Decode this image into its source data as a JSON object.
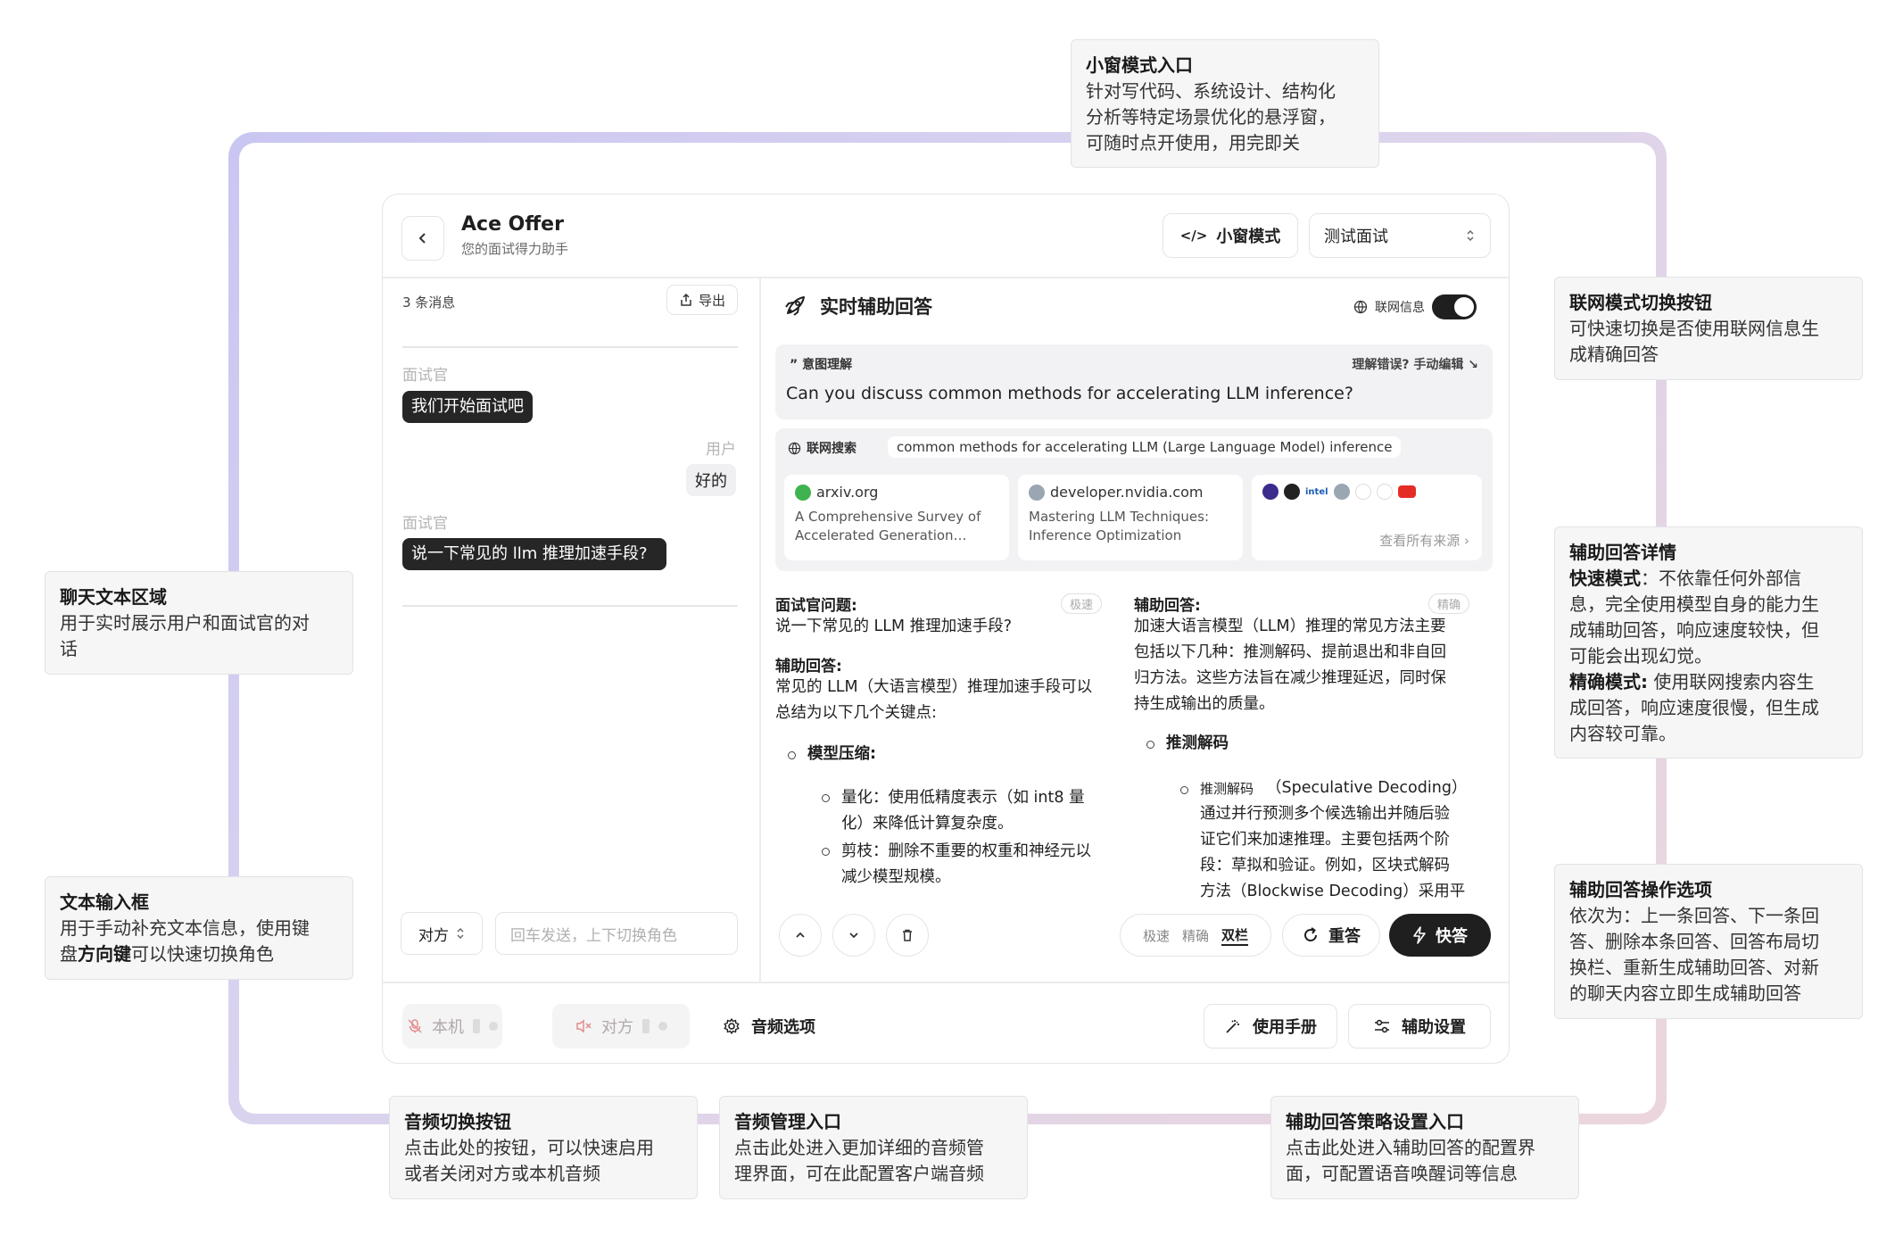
{
  "app": {
    "title": "Ace Offer",
    "subtitle": "您的面试得力助手",
    "mini_mode_label": "小窗模式",
    "interview_select": "测试面试"
  },
  "chat": {
    "message_count": "3 条消息",
    "export_label": "导出",
    "messages": [
      {
        "role": "面试官",
        "text": "我们开始面试吧"
      },
      {
        "role": "用户",
        "text": "好的"
      },
      {
        "role": "面试官",
        "text": "说一下常见的 llm 推理加速手段?"
      }
    ],
    "role_selector": "对方",
    "input_placeholder": "回车发送，上下切换角色"
  },
  "assist": {
    "title": "实时辅助回答",
    "web_toggle_label": "联网信息",
    "web_toggle_on": true,
    "intent_label": "意图理解",
    "intent_edit": "理解错误? 手动编辑",
    "intent_question": "Can you discuss common methods for accelerating LLM inference?",
    "search_label": "联网搜索",
    "search_query": "common methods for accelerating LLM (Large Language Model) inference",
    "sources": [
      {
        "domain": "arxiv.org",
        "title": "A Comprehensive Survey of Accelerated Generation…",
        "icon": "arxiv-icon",
        "color": "#3fb34f"
      },
      {
        "domain": "developer.nvidia.com",
        "title": "Mastering LLM Techniques: Inference Optimization",
        "icon": "nvidia-icon",
        "color": "#9aa6b2"
      }
    ],
    "more_sources": "查看所有来源",
    "left_col": {
      "q_head": "面试官问题:",
      "mode_pill": "极速",
      "q_text": "说一下常见的 LLM 推理加速手段?",
      "a_head": "辅助回答:",
      "a_text_1": "常见的 LLM（大语言模型）推理加速手段可以",
      "a_text_2": "总结为以下几个关键点:",
      "bullet": "模型压缩:",
      "sub1_1": "量化：使用低精度表示（如 int8 量",
      "sub1_2": "化）来降低计算复杂度。",
      "sub2_1": "剪枝：删除不重要的权重和神经元以",
      "sub2_2": "减少模型规模。"
    },
    "right_col": {
      "a_head": "辅助回答:",
      "mode_pill": "精确",
      "p1": "加速大语言模型（LLM）推理的常见方法主要",
      "p2": "包括以下几种：推测解码、提前退出和非自回",
      "p3": "归方法。这些方法旨在减少推理延迟，同时保",
      "p4": "持生成输出的质量。",
      "bullet": "推测解码",
      "sub_small": "推测解码",
      "sub_head": "（Speculative Decoding）",
      "s1": "通过并行预测多个候选输出并随后验",
      "s2": "证它们来加速推理。主要包括两个阶",
      "s3": "段：草拟和验证。例如，区块式解码",
      "s4": "方法（Blockwise Decoding）采用平"
    },
    "layout_options": [
      "极速",
      "精确",
      "双栏"
    ],
    "layout_active": "双栏",
    "regen_label": "重答",
    "fast_label": "快答"
  },
  "footer": {
    "mic_label": "本机",
    "speaker_label": "对方",
    "audio_options": "音频选项",
    "manual": "使用手册",
    "assist_settings": "辅助设置"
  },
  "callouts": {
    "mini": {
      "title": "小窗模式入口",
      "lines": [
        "针对写代码、系统设计、结构化",
        "分析等特定场景优化的悬浮窗，",
        "可随时点开使用，用完即关"
      ]
    },
    "web": {
      "title": "联网模式切换按钮",
      "lines": [
        "可快速切换是否使用联网信息生",
        "成精确回答"
      ]
    },
    "chat_area": {
      "title": "聊天文本区域",
      "lines": [
        "用于实时展示用户和面试官的对",
        "话"
      ]
    },
    "detail": {
      "title": "辅助回答详情",
      "fast_k": "快速模式",
      "fast_1": "：不依靠任何外部信",
      "lines_fast": [
        "息，完全使用模型自身的能力生",
        "成辅助回答，响应速度较快，但",
        "可能会出现幻觉。"
      ],
      "acc_k": "精确模式:",
      "acc_1": " 使用联网搜索内容生",
      "lines_acc": [
        "成回答，响应速度很慢，但生成",
        "内容较可靠。"
      ]
    },
    "input": {
      "title": "文本输入框",
      "line1": "用于手动补充文本信息，使用键",
      "line2_pre": "盘",
      "line2_key": "方向键",
      "line2_post": "可以快速切换角色"
    },
    "ops": {
      "title": "辅助回答操作选项",
      "lines": [
        "依次为：上一条回答、下一条回",
        "答、删除本条回答、回答布局切",
        "换栏、重新生成辅助回答、对新",
        "的聊天内容立即生成辅助回答"
      ]
    },
    "audio_switch": {
      "title": "音频切换按钮",
      "lines": [
        "点击此处的按钮，可以快速启用",
        "或者关闭对方或本机音频"
      ]
    },
    "audio_mgmt": {
      "title": "音频管理入口",
      "lines": [
        "点击此处进入更加详细的音频管",
        "理界面，可在此配置客户端音频"
      ]
    },
    "strategy": {
      "title": "辅助回答策略设置入口",
      "lines": [
        "点击此处进入辅助回答的配置界",
        "面，可配置语音唤醒词等信息"
      ]
    }
  }
}
